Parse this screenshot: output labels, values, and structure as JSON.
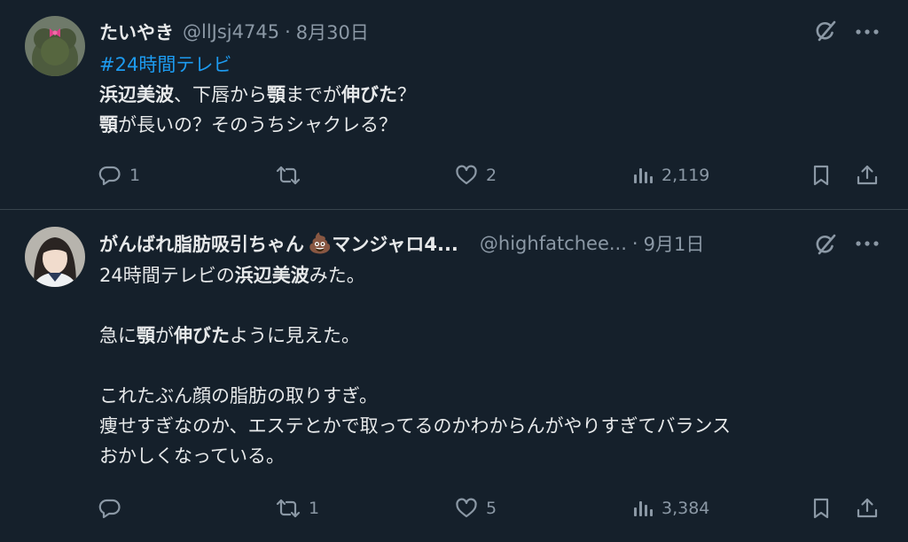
{
  "tweets": [
    {
      "name": "たいやき",
      "handle": "@llJsj4745",
      "date": "8月30日",
      "body": {
        "hashtag": "#24時間テレビ",
        "line2": [
          {
            "t": "浜辺美波",
            "b": true
          },
          {
            "t": "、下唇から",
            "b": false
          },
          {
            "t": "顎",
            "b": true
          },
          {
            "t": "までが",
            "b": false
          },
          {
            "t": "伸びた",
            "b": true
          },
          {
            "t": "？",
            "b": false
          }
        ],
        "line3": [
          {
            "t": "顎",
            "b": true
          },
          {
            "t": "が長いの？そのうちシャクレる？",
            "b": false
          }
        ]
      },
      "actions": {
        "reply": "1",
        "retweet": "",
        "like": "2",
        "views": "2,119"
      }
    },
    {
      "name": "がんばれ脂肪吸引ちゃん",
      "name_emoji": "💩",
      "name_suffix": "マンジャロ4...",
      "handle": "@highfatchee...",
      "date": "9月1日",
      "body": {
        "line1": [
          {
            "t": "24時間テレビの",
            "b": false
          },
          {
            "t": "浜辺美波",
            "b": true
          },
          {
            "t": "みた。",
            "b": false
          }
        ],
        "line2": [
          {
            "t": "急に",
            "b": false
          },
          {
            "t": "顎",
            "b": true
          },
          {
            "t": "が",
            "b": false
          },
          {
            "t": "伸びた",
            "b": true
          },
          {
            "t": "ように見えた。",
            "b": false
          }
        ],
        "line3": "これたぶん顔の脂肪の取りすぎ。",
        "line4": "痩せすぎなのか、エステとかで取ってるのかわからんがやりすぎてバランス",
        "line5": "おかしくなっている。"
      },
      "actions": {
        "reply": "",
        "retweet": "1",
        "like": "5",
        "views": "3,384"
      }
    }
  ],
  "colors": {
    "background": "#15202b",
    "text": "#e7e9ea",
    "secondary": "#8b98a5",
    "link": "#1d9bf0",
    "divider": "#38444d"
  },
  "icons": [
    "grok-icon",
    "more-icon",
    "reply-icon",
    "retweet-icon",
    "like-icon",
    "views-icon",
    "bookmark-icon",
    "share-icon"
  ]
}
